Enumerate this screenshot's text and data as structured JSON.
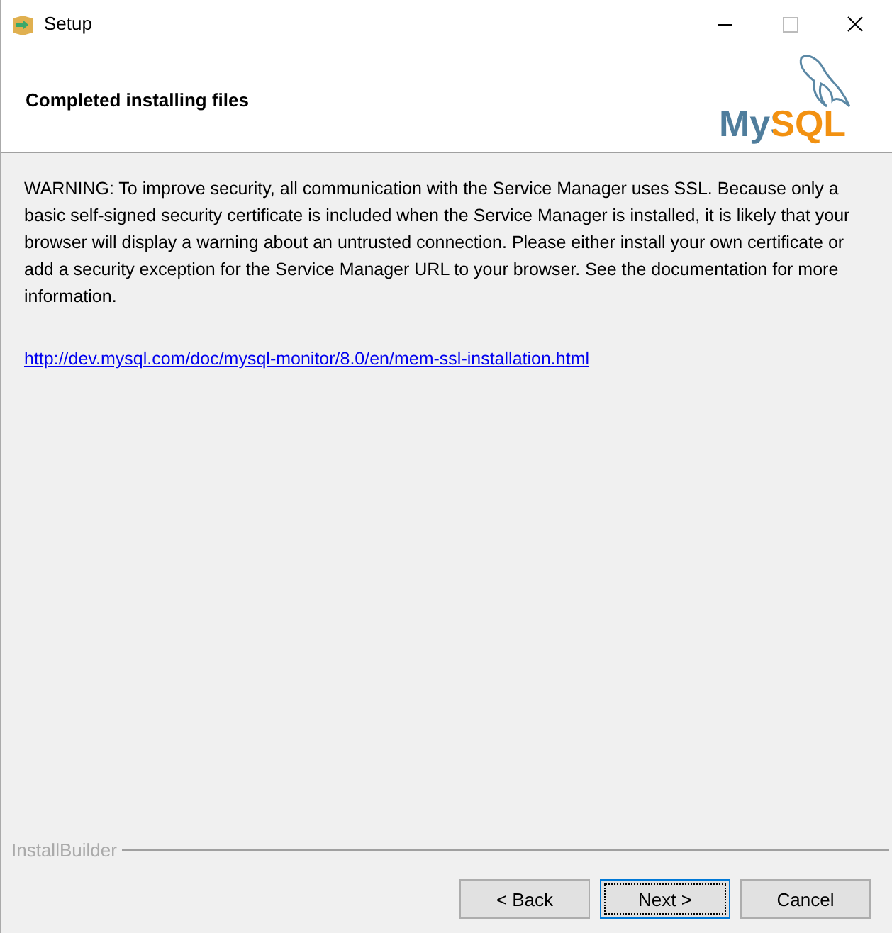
{
  "window": {
    "title": "Setup"
  },
  "header": {
    "title": "Completed installing files",
    "logo": "MySQL"
  },
  "message": "WARNING: To improve security, all communication with the Service Manager uses SSL. Because only a basic self-signed security certificate is included when the Service Manager is installed, it is likely that your browser will display a warning about an untrusted connection. Please either install your own certificate or add a security exception for the Service Manager URL to your browser. See the documentation for more information.",
  "link": "http://dev.mysql.com/doc/mysql-monitor/8.0/en/mem-ssl-installation.html",
  "footer": {
    "brand": "InstallBuilder"
  },
  "buttons": [
    {
      "label": "< Back",
      "focused": false
    },
    {
      "label": "Next >",
      "focused": true
    },
    {
      "label": "Cancel",
      "focused": false
    }
  ]
}
